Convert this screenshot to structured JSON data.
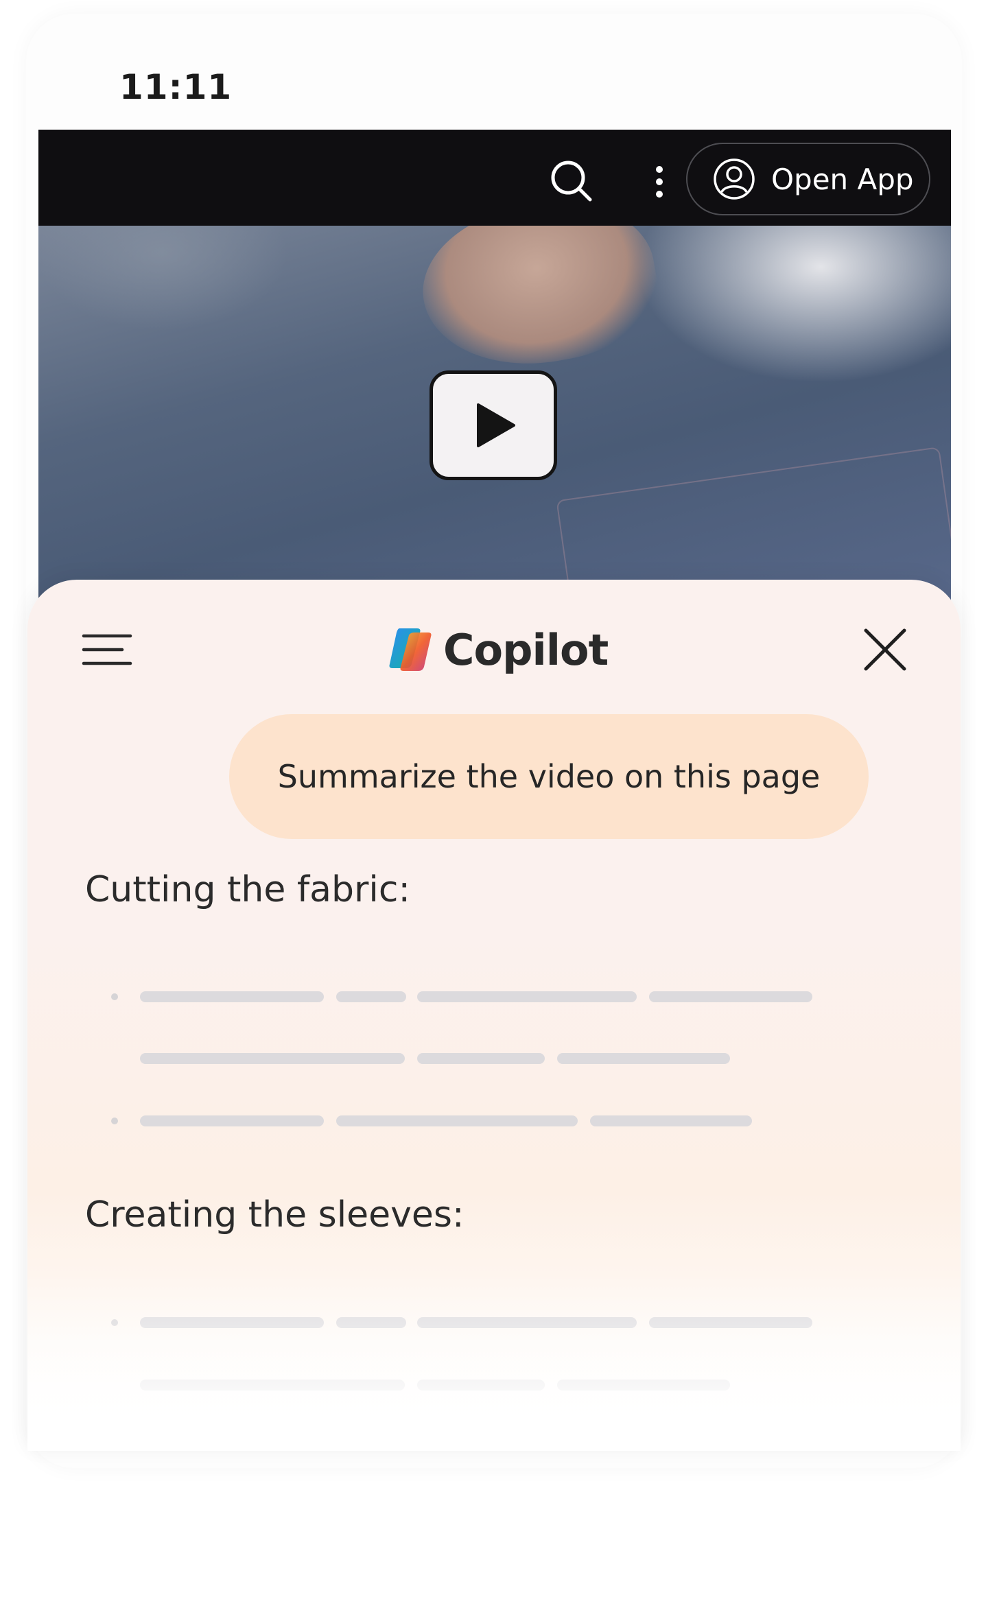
{
  "status_bar": {
    "time": "11:11"
  },
  "browser_bar": {
    "open_app_label": "Open App",
    "icons": [
      "search-icon",
      "more-vertical-icon",
      "user-circle-icon"
    ],
    "background": "#0f0e11"
  },
  "video": {
    "icon": "play-icon"
  },
  "copilot": {
    "title": "Copilot",
    "icons": [
      "menu-icon",
      "copilot-logo",
      "close-icon"
    ],
    "prompt": "Summarize the video on this page",
    "sections": [
      {
        "heading": "Cutting the fabric:"
      },
      {
        "heading": "Creating the sleeves:"
      }
    ],
    "colors": {
      "bubble": "#fde3cd",
      "sheet": "#fbf1ee"
    }
  }
}
